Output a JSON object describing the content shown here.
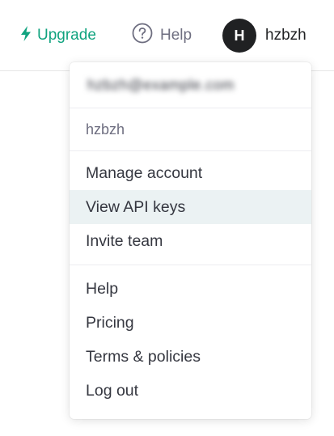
{
  "header": {
    "upgrade_label": "Upgrade",
    "help_label": "Help",
    "user_initial": "H",
    "username": "hzbzh"
  },
  "dropdown": {
    "email": "hzbzh@example.com",
    "username": "hzbzh",
    "account_items": [
      {
        "label": "Manage account"
      },
      {
        "label": "View API keys"
      },
      {
        "label": "Invite team"
      }
    ],
    "support_items": [
      {
        "label": "Help"
      },
      {
        "label": "Pricing"
      },
      {
        "label": "Terms & policies"
      },
      {
        "label": "Log out"
      }
    ],
    "highlighted_item": "View API keys"
  },
  "colors": {
    "brand_green": "#10a37f",
    "text_primary": "#353740",
    "text_secondary": "#6e6e80",
    "avatar_bg": "#202123",
    "hover_bg": "#ebf2f3"
  },
  "icons": {
    "upgrade": "lightning-bolt-icon",
    "help": "question-circle-icon"
  }
}
